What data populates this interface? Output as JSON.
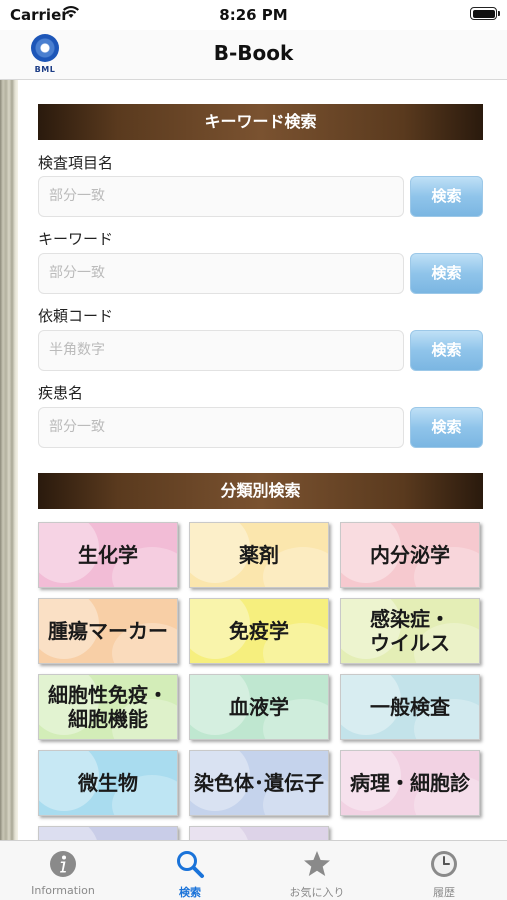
{
  "status_bar": {
    "carrier": "Carrier",
    "time": "8:26 PM"
  },
  "nav": {
    "title": "B-Book",
    "logo_text": "BML"
  },
  "keyword_search": {
    "header": "キーワード検索",
    "fields": [
      {
        "label": "検査項目名",
        "placeholder": "部分一致",
        "button": "検索"
      },
      {
        "label": "キーワード",
        "placeholder": "部分一致",
        "button": "検索"
      },
      {
        "label": "依頼コード",
        "placeholder": "半角数字",
        "button": "検索"
      },
      {
        "label": "疾患名",
        "placeholder": "部分一致",
        "button": "検索"
      }
    ]
  },
  "category_search": {
    "header": "分類別検索",
    "categories": [
      {
        "label": "生化学",
        "color": "#f2bcd6"
      },
      {
        "label": "薬剤",
        "color": "#fbe6ad"
      },
      {
        "label": "内分泌学",
        "color": "#f6c9cf"
      },
      {
        "label": "腫瘍マーカー",
        "color": "#f8cfa6"
      },
      {
        "label": "免疫学",
        "color": "#f6ef7e"
      },
      {
        "label": "感染症・\nウイルス",
        "color": "#e4eeb6"
      },
      {
        "label": "細胞性免疫・\n細胞機能",
        "color": "#d3edb8"
      },
      {
        "label": "血液学",
        "color": "#bfe7d0"
      },
      {
        "label": "一般検査",
        "color": "#c3e3ea"
      },
      {
        "label": "微生物",
        "color": "#a9dcef"
      },
      {
        "label": "染色体･遺伝子",
        "color": "#c5d3ec"
      },
      {
        "label": "病理・細胞診",
        "color": "#f2d2e3"
      },
      {
        "label": "",
        "color": "#c9cde8"
      },
      {
        "label": "",
        "color": "#ddd3e8"
      }
    ]
  },
  "tab_bar": {
    "tabs": [
      {
        "label": "Information",
        "icon": "info-icon",
        "active": false
      },
      {
        "label": "検索",
        "icon": "search-icon",
        "active": true
      },
      {
        "label": "お気に入り",
        "icon": "star-icon",
        "active": false
      },
      {
        "label": "履歴",
        "icon": "clock-icon",
        "active": false
      }
    ]
  }
}
